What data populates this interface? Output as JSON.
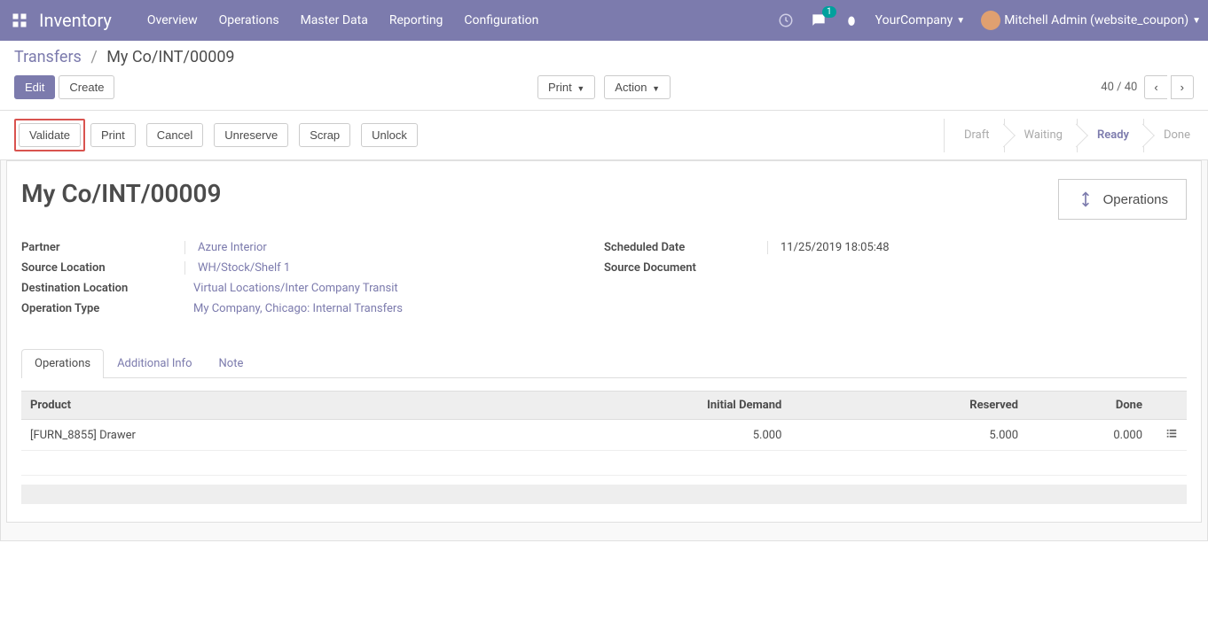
{
  "nav": {
    "app_name": "Inventory",
    "menu": [
      "Overview",
      "Operations",
      "Master Data",
      "Reporting",
      "Configuration"
    ],
    "chat_count": "1",
    "company": "YourCompany",
    "user": "Mitchell Admin (website_coupon)"
  },
  "breadcrumb": {
    "root": "Transfers",
    "current": "My Co/INT/00009"
  },
  "buttons": {
    "edit": "Edit",
    "create": "Create",
    "print": "Print",
    "action": "Action"
  },
  "pager": {
    "text": "40 / 40"
  },
  "statusbar": {
    "validate": "Validate",
    "print": "Print",
    "cancel": "Cancel",
    "unreserve": "Unreserve",
    "scrap": "Scrap",
    "unlock": "Unlock",
    "stages": [
      "Draft",
      "Waiting",
      "Ready",
      "Done"
    ],
    "active_stage": 2
  },
  "record": {
    "title": "My Co/INT/00009",
    "operations_btn": "Operations",
    "fields": {
      "partner_label": "Partner",
      "partner_value": "Azure Interior",
      "source_loc_label": "Source Location",
      "source_loc_value": "WH/Stock/Shelf 1",
      "dest_loc_label": "Destination Location",
      "dest_loc_value": "Virtual Locations/Inter Company Transit",
      "op_type_label": "Operation Type",
      "op_type_value": "My Company, Chicago: Internal Transfers",
      "sched_label": "Scheduled Date",
      "sched_value": "11/25/2019 18:05:48",
      "srcdoc_label": "Source Document",
      "srcdoc_value": ""
    }
  },
  "tabs": [
    "Operations",
    "Additional Info",
    "Note"
  ],
  "table": {
    "headers": {
      "product": "Product",
      "initial": "Initial Demand",
      "reserved": "Reserved",
      "done": "Done"
    },
    "rows": [
      {
        "product": "[FURN_8855] Drawer",
        "initial": "5.000",
        "reserved": "5.000",
        "done": "0.000"
      }
    ]
  }
}
